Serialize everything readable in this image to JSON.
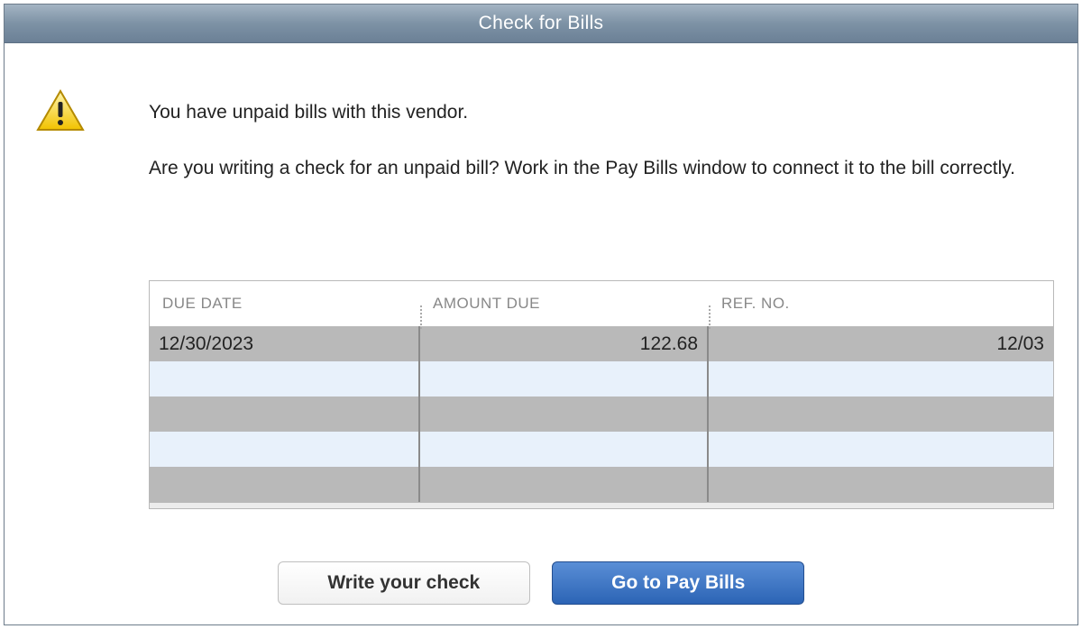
{
  "window": {
    "title": "Check for Bills"
  },
  "message": {
    "line1": "You have unpaid bills with this vendor.",
    "line2": "Are you writing a check for an unpaid bill? Work in the Pay Bills window to connect it to the bill correctly."
  },
  "table": {
    "headers": {
      "due_date": "DUE DATE",
      "amount_due": "AMOUNT DUE",
      "ref_no": "REF. NO."
    },
    "rows": [
      {
        "due_date": "12/30/2023",
        "amount_due": "122.68",
        "ref_no": "12/03"
      },
      {
        "due_date": "",
        "amount_due": "",
        "ref_no": ""
      },
      {
        "due_date": "",
        "amount_due": "",
        "ref_no": ""
      },
      {
        "due_date": "",
        "amount_due": "",
        "ref_no": ""
      },
      {
        "due_date": "",
        "amount_due": "",
        "ref_no": ""
      }
    ]
  },
  "buttons": {
    "write_check": "Write your check",
    "go_to_pay_bills": "Go to Pay Bills"
  }
}
